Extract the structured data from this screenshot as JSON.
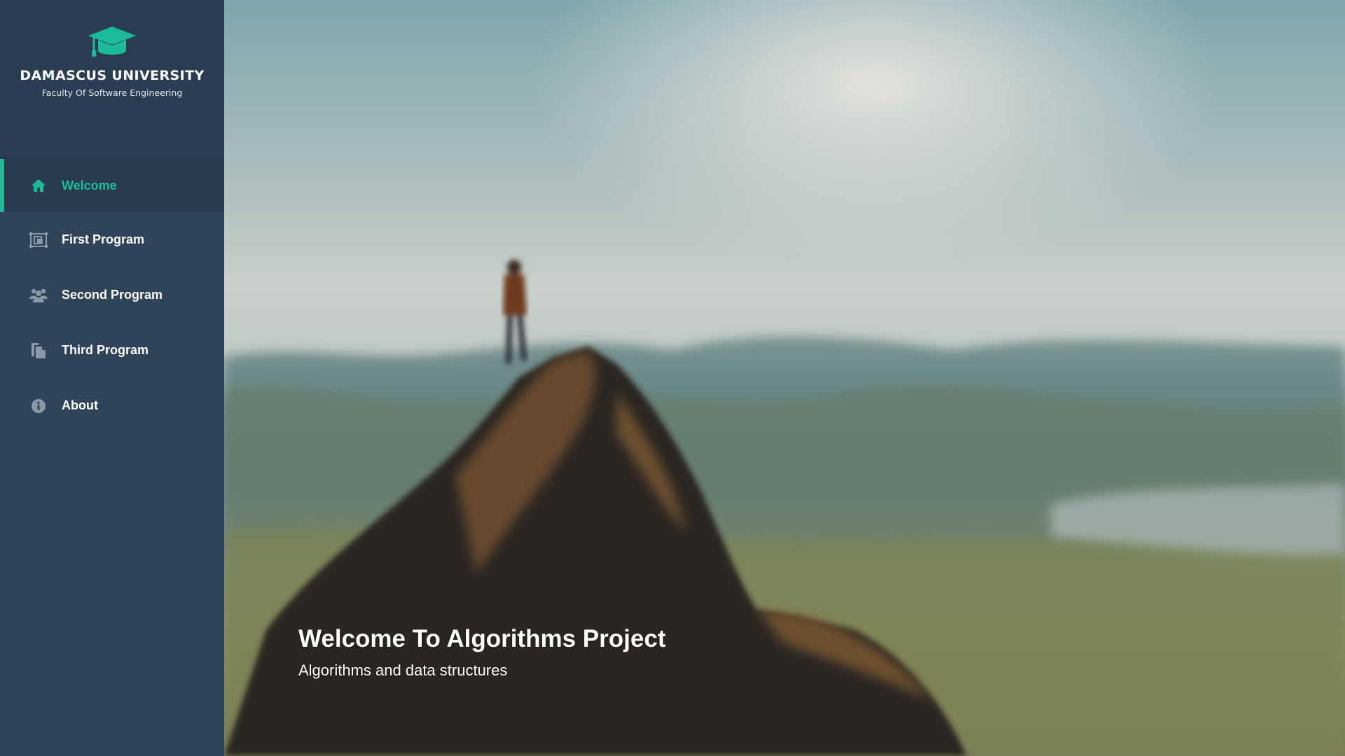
{
  "brand": {
    "icon": "graduation-cap-icon",
    "title": "DAMASCUS UNIVERSITY",
    "subtitle": "Faculty Of Software Engineering",
    "accent": "#1cbc9b"
  },
  "sidebar": {
    "items": [
      {
        "label": "Welcome",
        "icon": "home-icon",
        "active": true
      },
      {
        "label": "First Program",
        "icon": "image-frame-icon",
        "active": false
      },
      {
        "label": "Second Program",
        "icon": "users-icon",
        "active": false
      },
      {
        "label": "Third Program",
        "icon": "documents-icon",
        "active": false
      },
      {
        "label": "About",
        "icon": "info-icon",
        "active": false
      }
    ]
  },
  "hero": {
    "title": "Welcome To Algorithms Project",
    "subtitle": "Algorithms and data structures"
  },
  "colors": {
    "sidebar": "#2f4359",
    "header": "#2b3d52",
    "active": "#1cbc9b",
    "icon": "#8a99a8"
  }
}
